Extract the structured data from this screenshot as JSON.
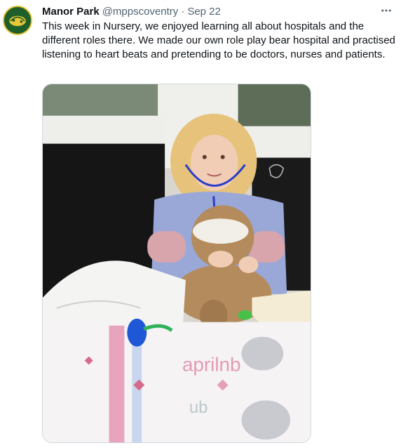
{
  "tweet": {
    "author_name": "Manor Park",
    "author_handle": "@mppscoventry",
    "separator": "·",
    "date": "Sep 22",
    "text": "This week in Nursery, we enjoyed learning all about hospitals and the different roles there. We made our own role play bear hospital and practised listening to heart beats and pretending to be doctors, nurses and patients.",
    "avatar_icon": "school-logo-icon",
    "more_icon": "more-options-icon",
    "photo_icon": "photo-child-teddy-stethoscope",
    "photo_text": [
      "aprilnb",
      "ub"
    ]
  },
  "colors": {
    "avatar_bg": "#1f5f2a",
    "avatar_ring": "#e8c738",
    "secondary_text": "#536471",
    "primary_text": "#0f1419"
  }
}
